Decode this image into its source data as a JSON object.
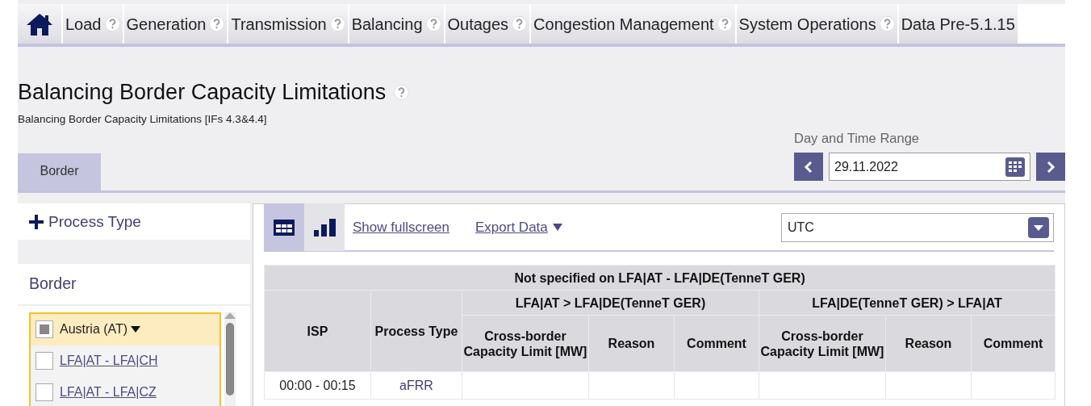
{
  "nav": {
    "items": [
      {
        "kind": "home",
        "help": false
      },
      {
        "kind": "text",
        "label": "Load",
        "help": true
      },
      {
        "kind": "text",
        "label": "Generation",
        "help": true
      },
      {
        "kind": "text",
        "label": "Transmission",
        "help": true
      },
      {
        "kind": "text",
        "label": "Balancing",
        "help": true
      },
      {
        "kind": "text",
        "label": "Outages",
        "help": true
      },
      {
        "kind": "text",
        "label": "Congestion Management",
        "help": true
      },
      {
        "kind": "text",
        "label": "System Operations",
        "help": true
      },
      {
        "kind": "text",
        "label": "Data Pre-5.1.15",
        "help": false
      }
    ]
  },
  "page": {
    "title": "Balancing Border Capacity Limitations",
    "title_help": true,
    "subtitle": "Balancing Border Capacity Limitations [IFs 4.3&4.4]"
  },
  "date_range": {
    "label": "Day and Time Range",
    "value": "29.11.2022"
  },
  "tabs": [
    {
      "label": "Border",
      "selected": true
    }
  ],
  "filters": {
    "process_type": {
      "label": "Process Type",
      "expanded": false
    },
    "border": {
      "title": "Border",
      "items": [
        {
          "kind": "group",
          "label": "Austria (AT)",
          "checked": false,
          "indeterminate": true,
          "selected": true
        },
        {
          "kind": "link",
          "label": "LFA|AT - LFA|CH",
          "checked": false,
          "indeterminate": false,
          "selected": false
        },
        {
          "kind": "link",
          "label": "LFA|AT - LFA|CZ",
          "checked": false,
          "indeterminate": false,
          "selected": false
        }
      ]
    }
  },
  "toolbar": {
    "views": [
      {
        "kind": "table",
        "selected": true
      },
      {
        "kind": "chart",
        "selected": false
      }
    ],
    "links": [
      {
        "label": "Show fullscreen",
        "dropdown": false
      },
      {
        "label": "Export Data",
        "dropdown": true
      }
    ],
    "timezone": "UTC"
  },
  "table": {
    "title": "Not specified on LFA|AT - LFA|DE(TenneT GER)",
    "groups": [
      "LFA|AT > LFA|DE(TenneT GER)",
      "LFA|DE(TenneT GER) > LFA|AT"
    ],
    "key_columns": [
      "ISP",
      "Process Type"
    ],
    "group_columns": [
      [
        "Cross-border Capacity Limit [MW]",
        "Reason",
        "Comment"
      ],
      [
        "Cross-border Capacity Limit [MW]",
        "Reason",
        "Comment"
      ]
    ],
    "rows": [
      {
        "isp": "00:00 - 00:15",
        "process_type": "aFRR"
      }
    ]
  }
}
